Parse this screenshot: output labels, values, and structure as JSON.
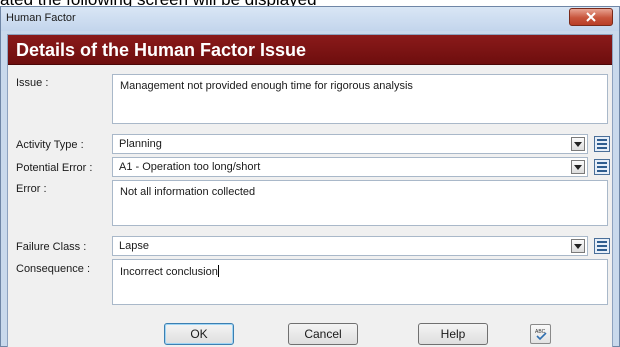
{
  "document_text": "ated the following screen will be displayed",
  "window": {
    "title": "Human Factor",
    "close_icon": "close-icon"
  },
  "header": {
    "title": "Details of the Human Factor Issue"
  },
  "form": {
    "issue": {
      "label": "Issue :",
      "value": "Management not provided enough time for rigorous analysis"
    },
    "activity_type": {
      "label": "Activity Type :",
      "value": "Planning"
    },
    "potential_error": {
      "label": "Potential Error :",
      "value": "A1 - Operation too long/short"
    },
    "error": {
      "label": "Error :",
      "value": "Not all information collected"
    },
    "failure_class": {
      "label": "Failure Class :",
      "value": "Lapse"
    },
    "consequence": {
      "label": "Consequence :",
      "value": "Incorrect conclusion"
    }
  },
  "buttons": {
    "ok": "OK",
    "cancel": "Cancel",
    "help": "Help"
  },
  "colors": {
    "header_bg": "#7a1212",
    "window_frame": "#c9d9ec",
    "client_bg": "#f0f0f0",
    "close_button": "#c8553c"
  },
  "icons": [
    "close-icon",
    "chevron-down-icon",
    "list-editor-icon",
    "spell-check-icon"
  ]
}
